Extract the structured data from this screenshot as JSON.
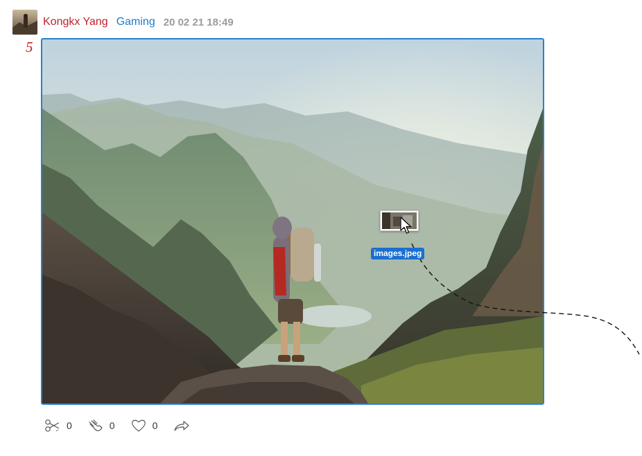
{
  "post": {
    "author": "Kongkx Yang",
    "category": "Gaming",
    "timestamp": "20 02 21 18:49",
    "number": "5"
  },
  "drag": {
    "file_label": "images.jpeg"
  },
  "actions": {
    "scissors_count": "0",
    "clap_count": "0",
    "like_count": "0"
  },
  "icons": {
    "scissors": "scissors-icon",
    "clap": "clap-hand-icon",
    "heart": "heart-icon",
    "share": "share-arrow-icon"
  },
  "colors": {
    "author": "#c2202b",
    "category": "#1f7ac4",
    "timestamp": "#9b9b9b",
    "frame_border": "#2b7fd0",
    "drag_label_bg": "#1a6fd1"
  }
}
